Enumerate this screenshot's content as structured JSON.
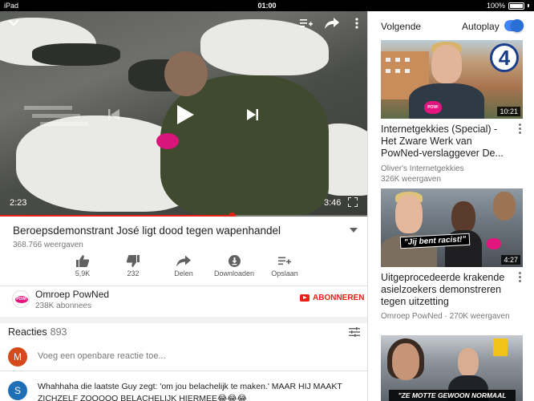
{
  "status_bar": {
    "device": "iPad",
    "time": "01:00",
    "battery": "100%"
  },
  "player": {
    "current_time": "2:23",
    "total_time": "3:46",
    "progress": 0.63
  },
  "video": {
    "title": "Beroepsdemonstrant José ligt dood tegen wapenhandel",
    "views": "368.766 weergaven",
    "actions": [
      {
        "label": "5,9K",
        "icon": "thumbs-up-icon"
      },
      {
        "label": "232",
        "icon": "thumbs-down-icon"
      },
      {
        "label": "Delen",
        "icon": "share-icon"
      },
      {
        "label": "Downloaden",
        "icon": "download-icon"
      },
      {
        "label": "Opslaan",
        "icon": "add-to-playlist-icon"
      }
    ]
  },
  "channel": {
    "name": "Omroep PowNed",
    "subscribers": "238K abonnees",
    "subscribe_label": "ABONNEREN",
    "avatar_text": "POW!"
  },
  "comments": {
    "heading": "Reacties",
    "count": "893",
    "add_placeholder": "Voeg een openbare reactie toe...",
    "my_avatar_letter": "M",
    "items": [
      {
        "avatar_letter": "S",
        "text": "Whahhaha die laatste Guy zegt: 'om jou belachelijk te maken.' MAAR HIJ MAAKT ZICHZELF ZOOOOO BELACHELIJK HIERMEE😂😂😂"
      }
    ]
  },
  "sidebar": {
    "next_label": "Volgende",
    "autoplay_label": "Autoplay",
    "autoplay_on": true,
    "recommendations": [
      {
        "title": "Internetgekkies (Special) - Het Zware Werk van PowNed-verslaggever De...",
        "channel": "Oliver's Internetgekkies",
        "views": "326K weergaven",
        "duration": "10:21",
        "logo_text": "4",
        "mic_text": "POW!"
      },
      {
        "title": "Uitgeprocedeerde krakende asielzoekers demonstreren tegen uitzetting",
        "channel": "Omroep PowNed",
        "views": "270K weergaven",
        "duration": "4:27",
        "caption": "\"Jij bent racist!\""
      },
      {
        "caption": "\"ZE MOTTE GEWOON NORMAAL DOEN\""
      }
    ]
  },
  "colors": {
    "accent": "#e62117",
    "toggle": "#4285f4",
    "brand_pink": "#e4157f"
  }
}
